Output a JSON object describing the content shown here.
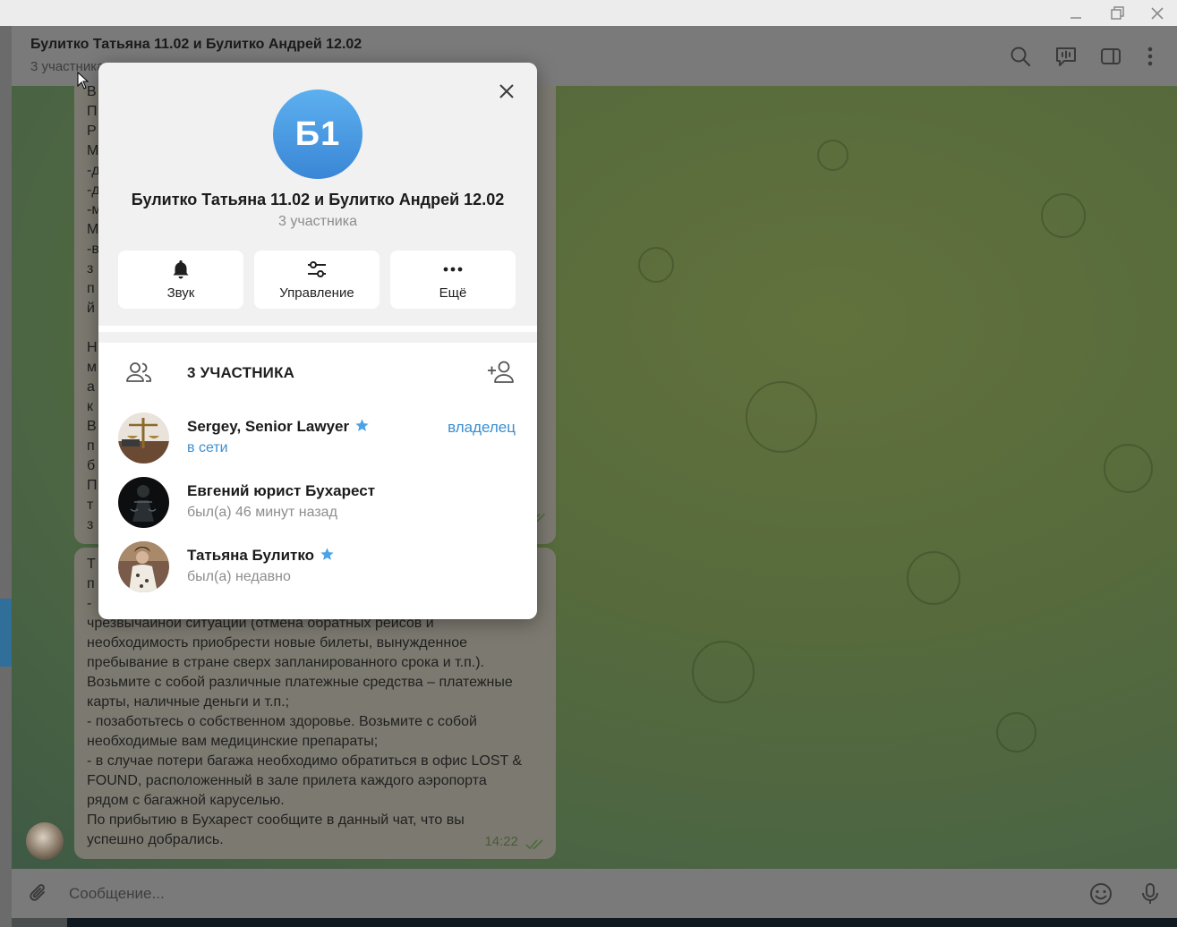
{
  "window": {
    "controls": [
      "minimize-icon",
      "restore-icon",
      "close-icon"
    ]
  },
  "chat": {
    "title": "Булитко Татьяна 11.02 и Булитко Андрей 12.02",
    "subtitle": "3 участника",
    "header_icons": [
      "search-icon",
      "voice-chat-icon",
      "sidebar-toggle-icon",
      "more-vertical-icon"
    ]
  },
  "messages": {
    "first_partial_letters": [
      "В",
      "П",
      "Р",
      "М",
      "-д",
      "-д",
      "-м",
      "М",
      "-в",
      "з",
      "п",
      "й",
      "",
      "Н",
      "м",
      "а",
      "к",
      "В",
      "п",
      "б",
      "П",
      "т",
      "з"
    ],
    "second_first_letters": [
      "Т",
      "п",
      "-"
    ],
    "second_lines": [
      "чрезвычайной ситуации (отмена обратных рейсов и",
      "необходимость приобрести новые билеты, вынужденное",
      "пребывание в стране сверх запланированного срока и т.п.).",
      "Возьмите с собой различные платежные средства – платежные",
      "карты, наличные деньги и т.п.;",
      "- позаботьтесь о собственном здоровье. Возьмите с собой",
      "необходимые вам медицинские препараты;",
      "- в случае потери багажа необходимо обратиться в офис LOST &",
      "FOUND, расположенный в зале прилета каждого аэропорта",
      "рядом с багажной каруселью.",
      "По прибытию в Бухарест сообщите в данный чат, что вы",
      "успешно добрались."
    ],
    "time": "14:22"
  },
  "composer": {
    "placeholder": "Сообщение...",
    "attach_icon": "paperclip-icon",
    "emoji_icon": "emoji-icon",
    "mic_icon": "microphone-icon"
  },
  "dialog": {
    "avatar_initials": "Б1",
    "avatar_color": "#4a9de3",
    "name": "Булитко Татьяна 11.02 и Булитко Андрей 12.02",
    "count": "3 участника",
    "actions": [
      {
        "label": "Звук",
        "icon": "bell-icon"
      },
      {
        "label": "Управление",
        "icon": "sliders-icon"
      },
      {
        "label": "Ещё",
        "icon": "more-horizontal-icon"
      }
    ],
    "members_title": "3 УЧАСТНИКА",
    "members": [
      {
        "name": "Sergey, Senior Lawyer",
        "status": "в сети",
        "role": "владелец",
        "premium": true,
        "online": true
      },
      {
        "name": "Евгений юрист Бухарест",
        "status": "был(а) 46 минут назад",
        "role": "",
        "premium": false,
        "online": false
      },
      {
        "name": "Татьяна Булитко",
        "status": "был(а) недавно",
        "role": "",
        "premium": true,
        "online": false
      }
    ]
  },
  "colors": {
    "accent": "#3a8fd1",
    "overlay": "#7a7a7a"
  }
}
